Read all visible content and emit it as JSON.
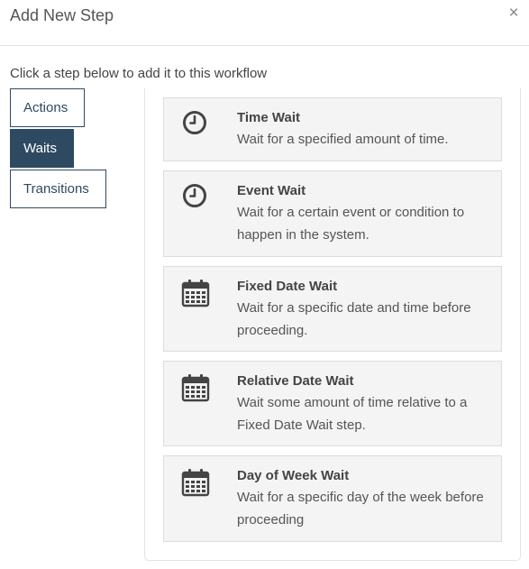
{
  "dialog": {
    "title": "Add New Step",
    "close_label": "×",
    "instruction": "Click a step below to add it to this workflow"
  },
  "tabs": [
    {
      "label": "Actions",
      "selected": false
    },
    {
      "label": "Waits",
      "selected": true
    },
    {
      "label": "Transitions",
      "selected": false
    }
  ],
  "steps": [
    {
      "title": "Time Wait",
      "description": "Wait for a specified amount of time.",
      "icon": "clock-icon"
    },
    {
      "title": "Event Wait",
      "description": "Wait for a certain event or condition to happen in the system.",
      "icon": "clock-icon"
    },
    {
      "title": "Fixed Date Wait",
      "description": "Wait for a specific date and time before proceeding.",
      "icon": "calendar-icon"
    },
    {
      "title": "Relative Date Wait",
      "description": "Wait some amount of time relative to a Fixed Date Wait step.",
      "icon": "calendar-icon"
    },
    {
      "title": "Day of Week Wait",
      "description": "Wait for a specific day of the week before proceeding",
      "icon": "calendar-icon"
    }
  ],
  "colors": {
    "accent": "#2e4a62",
    "card_bg": "#f4f4f4",
    "icon": "#444444"
  }
}
